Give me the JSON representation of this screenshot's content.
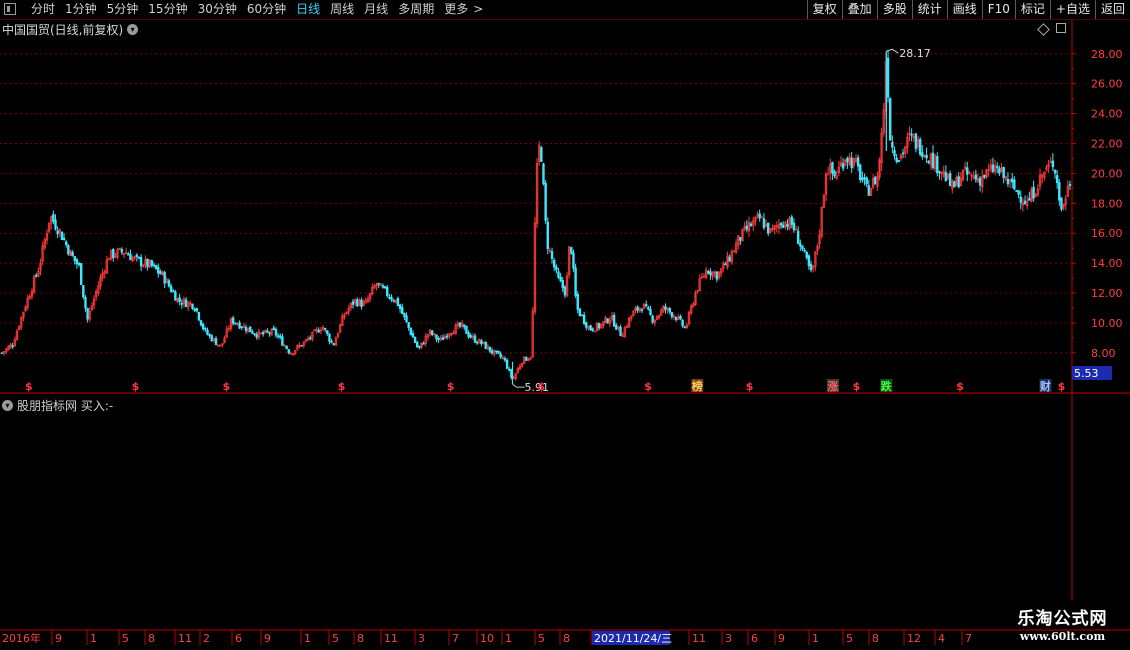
{
  "toolbar": {
    "periods": [
      "分时",
      "1分钟",
      "5分钟",
      "15分钟",
      "30分钟",
      "60分钟",
      "日线",
      "周线",
      "月线",
      "多周期",
      "更多"
    ],
    "active_period": "日线",
    "buttons": [
      "复权",
      "叠加",
      "多股",
      "统计",
      "画线",
      "F10",
      "标记",
      "+自选",
      "返回"
    ]
  },
  "stock_title": "中国国贸(日线,前复权)",
  "indicator_label": "股朋指标网 买入:-",
  "colors": {
    "up": "#ff3a3a",
    "down": "#3ee8ff",
    "grid": "#7a0000",
    "axis": "#c00000",
    "price_box": "#1c2ab0"
  },
  "icons": {
    "toolbar_left": "panel-icon",
    "collapse": "chevron-down-icon",
    "diamond": "diamond-icon",
    "restore": "restore-icon"
  },
  "chart_data": {
    "type": "candlestick",
    "y_ticks": [
      "28.00",
      "26.00",
      "24.00",
      "22.00",
      "20.00",
      "18.00",
      "16.00",
      "14.00",
      "12.00",
      "10.00",
      "8.00"
    ],
    "ylim": [
      6.72,
      28.92
    ],
    "current_price": "5.53",
    "annotations": {
      "high": "28.17",
      "low": "5.91"
    },
    "x_labels": [
      "2016年",
      "9",
      "1",
      "5",
      "8",
      "11",
      "2",
      "6",
      "9",
      "1",
      "5",
      "8",
      "11",
      "3",
      "7",
      "10",
      "1",
      "5",
      "8",
      "2021/11/24/三",
      "11",
      "3",
      "6",
      "9",
      "1",
      "5",
      "8",
      "12",
      "4",
      "7"
    ],
    "markers": [
      {
        "x": 0.025,
        "label": "$",
        "color": "#ff3a3a"
      },
      {
        "x": 0.125,
        "label": "$",
        "color": "#ff3a3a"
      },
      {
        "x": 0.21,
        "label": "$",
        "color": "#ff3a3a"
      },
      {
        "x": 0.318,
        "label": "$",
        "color": "#ff3a3a"
      },
      {
        "x": 0.42,
        "label": "$",
        "color": "#ff3a3a"
      },
      {
        "x": 0.505,
        "label": "$",
        "color": "#ff3a3a"
      },
      {
        "x": 0.605,
        "label": "$",
        "color": "#ff3a3a"
      },
      {
        "x": 0.651,
        "label": "榜",
        "color": "#ffd060",
        "bg": "#7a3a10"
      },
      {
        "x": 0.7,
        "label": "$",
        "color": "#ff3a3a"
      },
      {
        "x": 0.778,
        "label": "涨",
        "color": "#ff6060",
        "bg": "#3a3a3a"
      },
      {
        "x": 0.8,
        "label": "$",
        "color": "#ff3a3a"
      },
      {
        "x": 0.828,
        "label": "跌",
        "color": "#40ff40",
        "bg": "#1a4a1a"
      },
      {
        "x": 0.897,
        "label": "$",
        "color": "#ff3a3a"
      },
      {
        "x": 0.977,
        "label": "财",
        "color": "#a0c0ff",
        "bg": "#20305a"
      },
      {
        "x": 0.992,
        "label": "$",
        "color": "#ff3a3a"
      }
    ],
    "close_path": [
      [
        0.0,
        8.0
      ],
      [
        0.01,
        8.6
      ],
      [
        0.02,
        10.8
      ],
      [
        0.035,
        13.8
      ],
      [
        0.045,
        17.2
      ],
      [
        0.055,
        16.0
      ],
      [
        0.065,
        14.5
      ],
      [
        0.072,
        13.8
      ],
      [
        0.08,
        10.2
      ],
      [
        0.09,
        12.5
      ],
      [
        0.1,
        14.5
      ],
      [
        0.115,
        14.8
      ],
      [
        0.125,
        14.2
      ],
      [
        0.14,
        13.8
      ],
      [
        0.15,
        13.2
      ],
      [
        0.165,
        11.5
      ],
      [
        0.18,
        11.2
      ],
      [
        0.19,
        9.4
      ],
      [
        0.205,
        8.4
      ],
      [
        0.215,
        10.2
      ],
      [
        0.225,
        9.8
      ],
      [
        0.24,
        9.2
      ],
      [
        0.255,
        9.4
      ],
      [
        0.27,
        8.0
      ],
      [
        0.285,
        8.8
      ],
      [
        0.3,
        9.8
      ],
      [
        0.31,
        8.5
      ],
      [
        0.32,
        10.5
      ],
      [
        0.33,
        11.5
      ],
      [
        0.34,
        11.2
      ],
      [
        0.35,
        12.6
      ],
      [
        0.36,
        12.0
      ],
      [
        0.37,
        11.4
      ],
      [
        0.38,
        9.8
      ],
      [
        0.39,
        8.2
      ],
      [
        0.4,
        9.4
      ],
      [
        0.41,
        8.8
      ],
      [
        0.42,
        9.5
      ],
      [
        0.43,
        9.8
      ],
      [
        0.44,
        9.0
      ],
      [
        0.45,
        8.6
      ],
      [
        0.46,
        8.0
      ],
      [
        0.47,
        7.6
      ],
      [
        0.478,
        6.2
      ],
      [
        0.487,
        7.5
      ],
      [
        0.496,
        7.8
      ],
      [
        0.5,
        19.5
      ],
      [
        0.504,
        22.4
      ],
      [
        0.51,
        15.5
      ],
      [
        0.52,
        13.0
      ],
      [
        0.528,
        12.0
      ],
      [
        0.532,
        15.8
      ],
      [
        0.538,
        11.0
      ],
      [
        0.55,
        9.6
      ],
      [
        0.56,
        9.8
      ],
      [
        0.57,
        10.4
      ],
      [
        0.58,
        9.2
      ],
      [
        0.59,
        10.6
      ],
      [
        0.6,
        11.2
      ],
      [
        0.61,
        10.2
      ],
      [
        0.62,
        11.0
      ],
      [
        0.63,
        10.5
      ],
      [
        0.64,
        9.6
      ],
      [
        0.65,
        12.2
      ],
      [
        0.66,
        13.6
      ],
      [
        0.67,
        13.2
      ],
      [
        0.68,
        14.2
      ],
      [
        0.69,
        15.6
      ],
      [
        0.7,
        16.5
      ],
      [
        0.71,
        17.0
      ],
      [
        0.72,
        16.0
      ],
      [
        0.73,
        16.8
      ],
      [
        0.74,
        16.6
      ],
      [
        0.75,
        14.8
      ],
      [
        0.758,
        13.2
      ],
      [
        0.765,
        15.8
      ],
      [
        0.772,
        20.5
      ],
      [
        0.78,
        19.8
      ],
      [
        0.79,
        21.2
      ],
      [
        0.8,
        20.5
      ],
      [
        0.81,
        18.8
      ],
      [
        0.82,
        19.8
      ],
      [
        0.825,
        23.5
      ],
      [
        0.828,
        28.17
      ],
      [
        0.832,
        22.0
      ],
      [
        0.84,
        21.0
      ],
      [
        0.85,
        22.4
      ],
      [
        0.86,
        21.8
      ],
      [
        0.87,
        21.0
      ],
      [
        0.88,
        20.2
      ],
      [
        0.89,
        19.0
      ],
      [
        0.9,
        20.0
      ],
      [
        0.915,
        19.6
      ],
      [
        0.93,
        20.4
      ],
      [
        0.945,
        19.2
      ],
      [
        0.96,
        18.0
      ],
      [
        0.975,
        20.0
      ],
      [
        0.985,
        20.8
      ],
      [
        0.992,
        17.5
      ],
      [
        1.0,
        19.5
      ]
    ]
  },
  "watermark": {
    "title": "乐淘公式网",
    "url": "www.60lt.com"
  }
}
